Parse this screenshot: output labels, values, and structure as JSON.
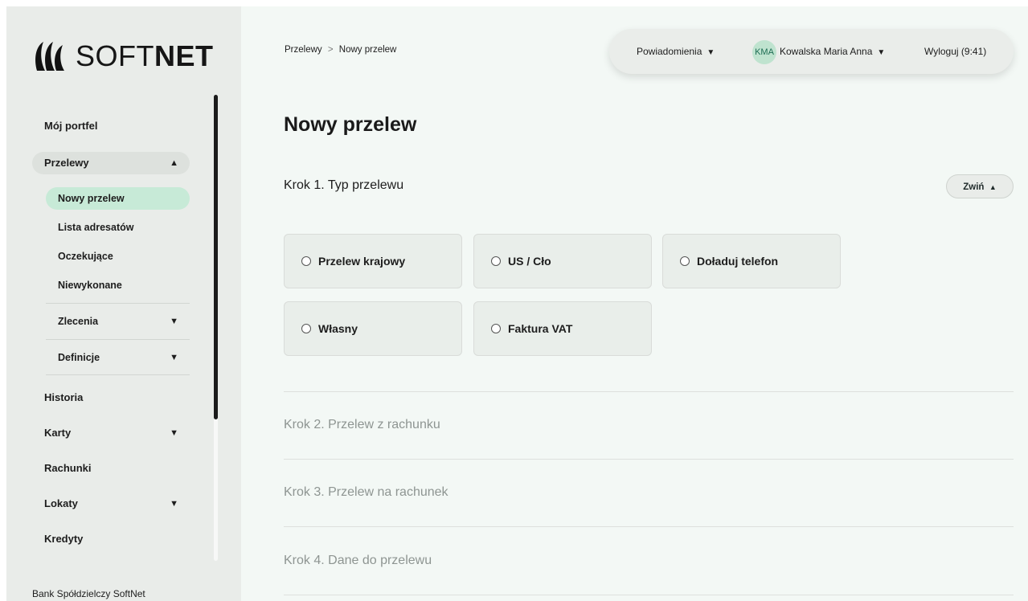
{
  "brand": {
    "logo_text_light": "SOFT",
    "logo_text_bold": "NET"
  },
  "sidebar": {
    "items": [
      {
        "label": "Mój portfel"
      },
      {
        "label": "Przelewy",
        "expanded": true
      },
      {
        "label": "Historia"
      },
      {
        "label": "Karty",
        "has_submenu": true
      },
      {
        "label": "Rachunki"
      },
      {
        "label": "Lokaty",
        "has_submenu": true
      },
      {
        "label": "Kredyty"
      }
    ],
    "przelewy_sub": [
      {
        "label": "Nowy przelew",
        "active": true
      },
      {
        "label": "Lista adresatów"
      },
      {
        "label": "Oczekujące"
      },
      {
        "label": "Niewykonane"
      },
      {
        "label": "Zlecenia",
        "has_submenu": true
      },
      {
        "label": "Definicje",
        "has_submenu": true
      }
    ],
    "footer": "Bank Spółdzielczy SoftNet"
  },
  "breadcrumb": {
    "parent": "Przelewy",
    "separator": ">",
    "current": "Nowy przelew"
  },
  "topbar": {
    "notifications": "Powiadomienia",
    "avatar_initials": "KMA",
    "user_name": "Kowalska Maria Anna",
    "logout": "Wyloguj (9:41)"
  },
  "page": {
    "title": "Nowy przelew"
  },
  "steps": [
    {
      "title": "Krok 1. Typ przelewu",
      "active": true
    },
    {
      "title": "Krok 2. Przelew z rachunku"
    },
    {
      "title": "Krok 3. Przelew na rachunek"
    },
    {
      "title": "Krok 4. Dane do przelewu"
    }
  ],
  "collapse_label": "Zwiń",
  "transfer_types": [
    {
      "label": "Przelew krajowy"
    },
    {
      "label": "US / Cło"
    },
    {
      "label": "Doładuj telefon"
    },
    {
      "label": "Własny"
    },
    {
      "label": "Faktura VAT"
    }
  ],
  "colors": {
    "active_green": "#c7ead7",
    "sidebar_bg": "#e9ece9",
    "main_bg": "#f3f8f5"
  }
}
